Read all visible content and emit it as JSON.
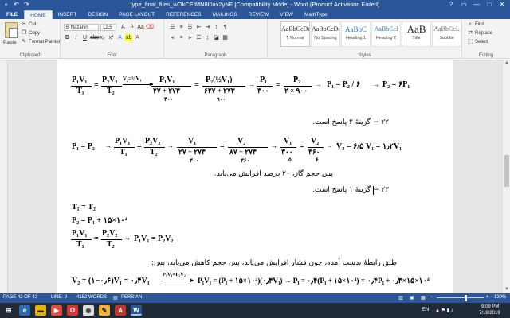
{
  "titlebar": {
    "title": "type_final_files_wOkCEfMN8l0ax2yNF [Compatibility Mode] - Word (Product Activation Failed)",
    "qat": [
      "save-icon",
      "undo-icon",
      "redo-icon"
    ],
    "controls": [
      "?",
      "▭",
      "—",
      "□",
      "✕"
    ]
  },
  "tabs": [
    "FILE",
    "HOME",
    "INSERT",
    "DESIGN",
    "PAGE LAYOUT",
    "REFERENCES",
    "MAILINGS",
    "REVIEW",
    "VIEW",
    "MathType"
  ],
  "ribbon": {
    "clipboard": {
      "paste": "Paste",
      "cut": "Cut",
      "copy": "Copy",
      "format_painter": "Format Painter",
      "label": "Clipboard"
    },
    "font": {
      "name": "B Nazanin",
      "size": "12.5",
      "label": "Font"
    },
    "paragraph": {
      "label": "Paragraph"
    },
    "styles": {
      "label": "Styles",
      "items": [
        {
          "preview": "AaBbCcDc",
          "name": "¶ Normal"
        },
        {
          "preview": "AaBbCcDc",
          "name": "No Spacing"
        },
        {
          "preview": "AaBbC",
          "name": "Heading 1"
        },
        {
          "preview": "AaBbCcl",
          "name": "Heading 2"
        },
        {
          "preview": "AaB",
          "name": "Title"
        },
        {
          "preview": "AaBbCcL",
          "name": "Subtitle"
        }
      ]
    },
    "editing": {
      "find": "Find",
      "replace": "Replace",
      "select": "Select",
      "label": "Editing"
    }
  },
  "document": {
    "eq1": {
      "part1_num": "P₁V₁",
      "part1_den": "T₁",
      "eq": "=",
      "part2_num": "P₂V₂",
      "part2_den": "T₂",
      "arrow_label": "V₂=½V₁",
      "part3_num": "P₁V₁",
      "part3_den": "۲۷ + ۲۷۳",
      "part3_sub": "۳۰۰",
      "part4_num": "P₂(½V₁)",
      "part4_den": "۶۲۷ + ۲۷۳",
      "part4_sub": "۹۰۰",
      "part5_num": "P₁",
      "part5_den": "۳۰۰",
      "part6_num": "P₂",
      "part6_den": "۲ × ۹۰۰",
      "result1": "P₁ = P₂ / ۶",
      "result2": "P₂ = ۶P₁"
    },
    "answer22": "۲۲ − گزینهٔ ۲ پاسخ است.",
    "eq2": {
      "lhs": "P₁ = P₂",
      "part1_num": "P₁V₁",
      "part1_den": "T₁",
      "part2_num": "P₂V₂",
      "part2_den": "T₂",
      "part3_num": "V₁",
      "part3_den": "۲۷ + ۲۷۳",
      "part3_sub": "۳۰۰",
      "part4_num": "V₂",
      "part4_den": "۸۷ + ۲۷۳",
      "part4_sub": "۳۶۰",
      "part5_num": "V₁",
      "part5_den": "۳۰۰",
      "part5_sub": "۵",
      "part6_num": "V₂",
      "part6_den": "۳۶۰",
      "part6_sub": "۶",
      "result": "V₂ = ۶/۵ V₁ = ۱٫۲V₁"
    },
    "conclusion22": "پس حجم گاز، ۲۰ درصد افزایش می‌یابد.",
    "answer23": "۲۳ − گزینهٔ ۱ پاسخ است.",
    "eq3_lines": [
      "T₁ = T₂",
      "P₂ = P₁ + ۱۵×۱۰⁴"
    ],
    "eq3_frac": {
      "num1": "P₁V₁",
      "den1": "T₁",
      "num2": "P₂V₂",
      "den2": "T₂",
      "result": "P₁V₁ = P₂V₂"
    },
    "relation_text": "طبق رابطهٔ بدست آمده، چون فشار افزایش می‌یابد، پس حجم کاهش می‌یابد، پس:",
    "eq4": {
      "lhs": "V₂ = (۱−۰٫۶)V₁ = ۰٫۴V₁",
      "arrow_label": "P₁V₁=P₂V₂",
      "rhs": "P₁V₁ = (P₁ + ۱۵×۱۰⁴)(۰٫۴V₁) → P₁ = ۰٫۴(P₁ + ۱۵×۱۰⁴) = ۰٫۴P₁ + ۰٫۴×۱۵×۱۰⁴"
    }
  },
  "statusbar": {
    "page": "PAGE 42 OF 42",
    "line": "LINE: 9",
    "words": "4152 WORDS",
    "language": "PERSIAN",
    "zoom": "130%"
  },
  "taskbar": {
    "lang": "EN",
    "time": "9:09 PM",
    "date": "7/18/2019"
  }
}
